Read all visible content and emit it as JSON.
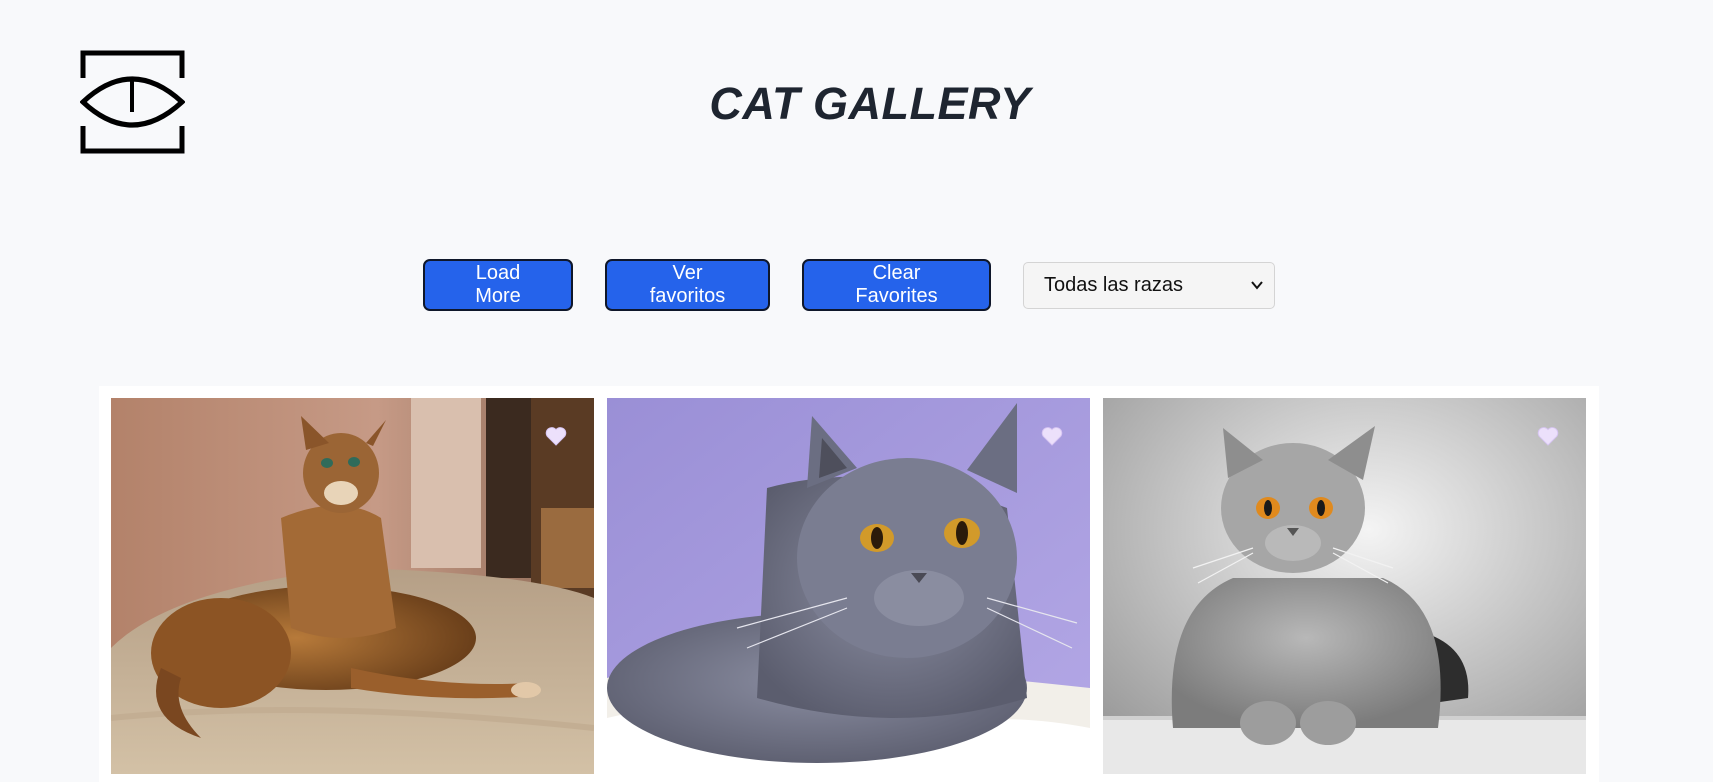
{
  "app": {
    "title": "CAT GALLERY",
    "logo": "eye-logo-icon"
  },
  "controls": {
    "load_more_label": "Load More",
    "favorites_label": "Ver favoritos",
    "clear_label": "Clear Favorites",
    "breed_select": {
      "selected": "Todas las razas",
      "icon": "chevron-down-icon"
    }
  },
  "colors": {
    "accent": "#2563eb",
    "background": "#f8f9fb",
    "heart": "#e9d5ff"
  },
  "gallery": {
    "cards": [
      {
        "subject": "bengal-tabby-cat-on-bed",
        "favorite_icon": "heart-icon",
        "favorited": false
      },
      {
        "subject": "grey-british-shorthair-purple-background",
        "favorite_icon": "heart-icon",
        "favorited": false
      },
      {
        "subject": "grey-british-shorthair-white-studio",
        "favorite_icon": "heart-icon",
        "favorited": false
      }
    ]
  }
}
